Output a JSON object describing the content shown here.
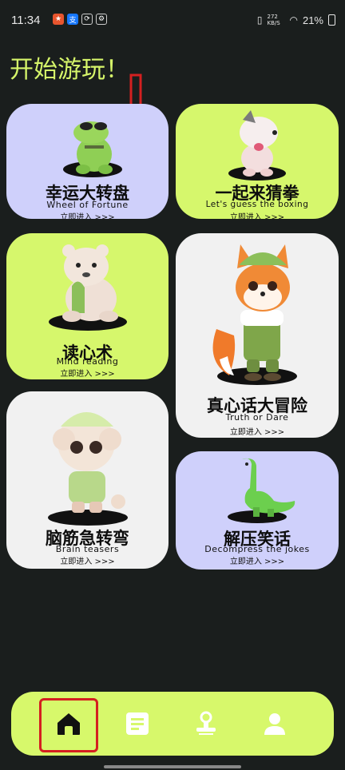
{
  "status": {
    "time": "11:34",
    "battery": "21%",
    "net": "272 KB/S"
  },
  "page": {
    "title": "开始游玩！"
  },
  "cards": [
    {
      "title": "幸运大转盘",
      "subtitle": "Wheel of Fortune",
      "enter": "立即进入 >>>",
      "color": "#cfd0fb"
    },
    {
      "title": "一起来猜拳",
      "subtitle": "Let's guess the boxing",
      "enter": "立即进入 >>>",
      "color": "#d6f76c"
    },
    {
      "title": "读心术",
      "subtitle": "Mind reading",
      "enter": "立即进入 >>>",
      "color": "#d6f76c"
    },
    {
      "title": "真心话大冒险",
      "subtitle": "Truth or Dare",
      "enter": "立即进入 >>>",
      "color": "#f1f1f1"
    },
    {
      "title": "脑筋急转弯",
      "subtitle": "Brain teasers",
      "enter": "立即进入 >>>",
      "color": "#f1f1f1"
    },
    {
      "title": "解压笑话",
      "subtitle": "Decompress the jokes",
      "enter": "立即进入 >>>",
      "color": "#cfd0fb"
    }
  ],
  "nav": {
    "items": [
      {
        "name": "home",
        "icon": "home-icon"
      },
      {
        "name": "list",
        "icon": "list-icon"
      },
      {
        "name": "stamp",
        "icon": "stamp-icon"
      },
      {
        "name": "profile",
        "icon": "user-icon"
      }
    ]
  },
  "colors": {
    "accent": "#d6f76c",
    "lavender": "#cfd0fb",
    "background": "#1a1e1d",
    "highlight": "#d42020"
  }
}
